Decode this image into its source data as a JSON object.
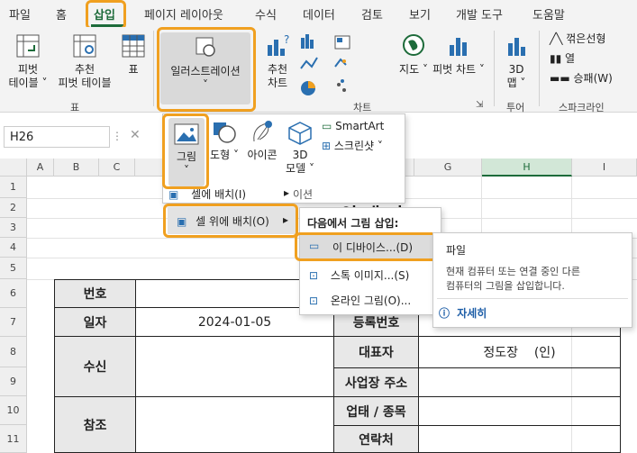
{
  "menubar": {
    "tabs": [
      "파일",
      "홈",
      "삽입",
      "페이지 레이아웃",
      "수식",
      "데이터",
      "검토",
      "보기",
      "개발 도구",
      "도움말"
    ]
  },
  "ribbon": {
    "pivot_table": [
      "피벗",
      "테이블"
    ],
    "recommended_pivot": [
      "추천",
      "피벗 테이블"
    ],
    "table": "표",
    "illustrations": "일러스트레이션",
    "recommended_charts": [
      "추천",
      "차트"
    ],
    "maps": "지도",
    "pivot_chart": "피벗 차트",
    "map_3d": [
      "3D",
      "맵"
    ],
    "sparkline_line": "꺾은선형",
    "sparkline_column": "열",
    "sparkline_winloss": "승패(W)",
    "group_table": "표",
    "group_charts": "차트",
    "group_tour": "투어",
    "group_sparklines": "스파크라인"
  },
  "formula_bar": {
    "name_box": "H26"
  },
  "sheet": {
    "columns": [
      "A",
      "B",
      "C",
      "D",
      "E",
      "F",
      "G",
      "H",
      "I"
    ],
    "rows": [
      "1",
      "2",
      "3",
      "4",
      "5",
      "6",
      "7",
      "8",
      "9",
      "10",
      "11"
    ],
    "title_fragment": "인 대 너",
    "label_number": "번호",
    "label_date": "일자",
    "date_value": "2024-01-05",
    "label_recipient": "수신",
    "label_reference": "참조",
    "label_regno": "등록번호",
    "label_ceo": "대표자",
    "ceo_value": "정도장    (인)",
    "label_address": "사업장 주소",
    "label_business": "업태 / 종목",
    "label_contact": "연락처"
  },
  "illustrations_menu": {
    "picture": "그림",
    "shapes": "도형",
    "icons": "아이콘",
    "models_3d": [
      "3D",
      "모델"
    ],
    "smartart": "SmartArt",
    "screenshot": "스크린샷",
    "place_in_cell": "셀에 배치(I)",
    "place_over_cells": "셀 위에 배치(O)",
    "caption_fragment": "이션"
  },
  "insert_from_menu": {
    "header": "다음에서 그림 삽입:",
    "this_device": "이 디바이스...(D)",
    "stock_images": "스톡 이미지...(S)",
    "online_pictures": "온라인 그림(O)..."
  },
  "tooltip": {
    "title": "파일",
    "body": [
      "현재 컴퓨터 또는 연결 중인 다른",
      "컴퓨터의 그림을 삽입합니다."
    ],
    "more": "자세히"
  },
  "colors": {
    "highlight": "#f0a020",
    "excel_green": "#1d6b3a",
    "selected_col": "#d2e7d7"
  }
}
